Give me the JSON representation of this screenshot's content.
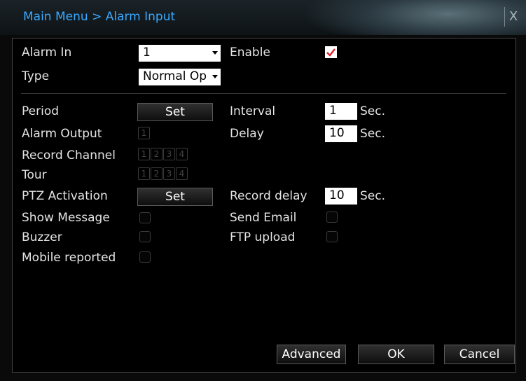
{
  "window": {
    "title": "Main Menu > Alarm Input",
    "close_icon": "X"
  },
  "form": {
    "alarm_in": {
      "label": "Alarm In",
      "value": "1"
    },
    "enable": {
      "label": "Enable",
      "checked": true,
      "check_color": "#e0202a"
    },
    "type": {
      "label": "Type",
      "value": "Normal Op"
    },
    "period": {
      "label": "Period",
      "button": "Set"
    },
    "interval": {
      "label": "Interval",
      "value": "1",
      "unit": "Sec."
    },
    "alarm_output": {
      "label": "Alarm Output",
      "channels": [
        "1"
      ]
    },
    "delay": {
      "label": "Delay",
      "value": "10",
      "unit": "Sec."
    },
    "record_channel": {
      "label": "Record Channel",
      "channels": [
        "1",
        "2",
        "3",
        "4"
      ]
    },
    "tour": {
      "label": "Tour",
      "channels": [
        "1",
        "2",
        "3",
        "4"
      ]
    },
    "ptz_activation": {
      "label": "PTZ Activation",
      "button": "Set"
    },
    "record_delay": {
      "label": "Record delay",
      "value": "10",
      "unit": "Sec."
    },
    "show_message": {
      "label": "Show Message",
      "checked": false
    },
    "send_email": {
      "label": "Send Email",
      "checked": false
    },
    "buzzer": {
      "label": "Buzzer",
      "checked": false
    },
    "ftp_upload": {
      "label": "FTP upload",
      "checked": false
    },
    "mobile_reported": {
      "label": "Mobile reported",
      "checked": false
    }
  },
  "buttons": {
    "advanced": "Advanced",
    "ok": "OK",
    "cancel": "Cancel"
  },
  "colors": {
    "title": "#3aa9ff",
    "panel_bg": "#000000",
    "text": "#e4e4e4"
  }
}
